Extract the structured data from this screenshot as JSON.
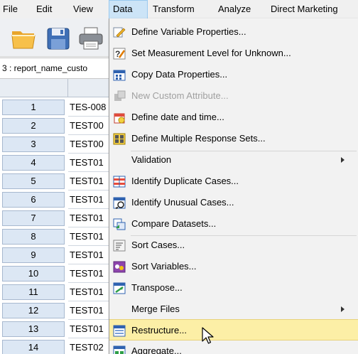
{
  "menubar": {
    "items": [
      {
        "label": "File",
        "active": false
      },
      {
        "label": "Edit",
        "active": false
      },
      {
        "label": "View",
        "active": false
      },
      {
        "label": "Data",
        "active": true
      },
      {
        "label": "Transform",
        "active": false
      },
      {
        "label": "Analyze",
        "active": false
      },
      {
        "label": "Direct Marketing",
        "active": false
      }
    ]
  },
  "toolbar": {
    "buttons": [
      "open-folder-icon",
      "save-icon",
      "print-icon"
    ]
  },
  "cell_reference": {
    "text": "3 : report_name_custo"
  },
  "grid": {
    "rows": [
      {
        "num": "1",
        "value": "TES-008"
      },
      {
        "num": "2",
        "value": "TEST00"
      },
      {
        "num": "3",
        "value": "TEST00"
      },
      {
        "num": "4",
        "value": "TEST01"
      },
      {
        "num": "5",
        "value": "TEST01"
      },
      {
        "num": "6",
        "value": "TEST01"
      },
      {
        "num": "7",
        "value": "TEST01"
      },
      {
        "num": "8",
        "value": "TEST01"
      },
      {
        "num": "9",
        "value": "TEST01"
      },
      {
        "num": "10",
        "value": "TEST01"
      },
      {
        "num": "11",
        "value": "TEST01"
      },
      {
        "num": "12",
        "value": "TEST01"
      },
      {
        "num": "13",
        "value": "TEST01"
      },
      {
        "num": "14",
        "value": "TEST02"
      }
    ]
  },
  "data_menu": {
    "items": [
      {
        "label": "Define Variable Properties...",
        "icon": "define-variable-properties-icon",
        "disabled": false
      },
      {
        "label": "Set Measurement Level for Unknown...",
        "icon": "measurement-level-icon",
        "disabled": false
      },
      {
        "label": "Copy Data Properties...",
        "icon": "copy-data-properties-icon",
        "disabled": false
      },
      {
        "label": "New Custom Attribute...",
        "icon": "custom-attribute-icon",
        "disabled": true
      },
      {
        "label": "Define date and time...",
        "icon": "calendar-icon",
        "disabled": false
      },
      {
        "label": "Define Multiple Response Sets...",
        "icon": "multiple-response-icon",
        "disabled": false
      },
      {
        "label": "Validation",
        "icon": "",
        "disabled": false,
        "submenu": true
      },
      {
        "label": "Identify Duplicate Cases...",
        "icon": "duplicate-cases-icon",
        "disabled": false
      },
      {
        "label": "Identify Unusual Cases...",
        "icon": "unusual-cases-icon",
        "disabled": false
      },
      {
        "label": "Compare Datasets...",
        "icon": "compare-datasets-icon",
        "disabled": false
      },
      {
        "label": "Sort Cases...",
        "icon": "sort-cases-icon",
        "disabled": false
      },
      {
        "label": "Sort Variables...",
        "icon": "sort-variables-icon",
        "disabled": false
      },
      {
        "label": "Transpose...",
        "icon": "transpose-icon",
        "disabled": false
      },
      {
        "label": "Merge Files",
        "icon": "",
        "disabled": false,
        "submenu": true
      },
      {
        "label": "Restructure...",
        "icon": "restructure-icon",
        "disabled": false,
        "highlighted": true
      },
      {
        "label": "Aggregate...",
        "icon": "aggregate-icon",
        "disabled": false
      }
    ]
  },
  "colors": {
    "menu_active_bg": "#cce4f7",
    "menu_highlight_bg": "#fcefa6",
    "row_header_bg": "#dce7f4",
    "disabled_text": "#a0a0a0"
  }
}
